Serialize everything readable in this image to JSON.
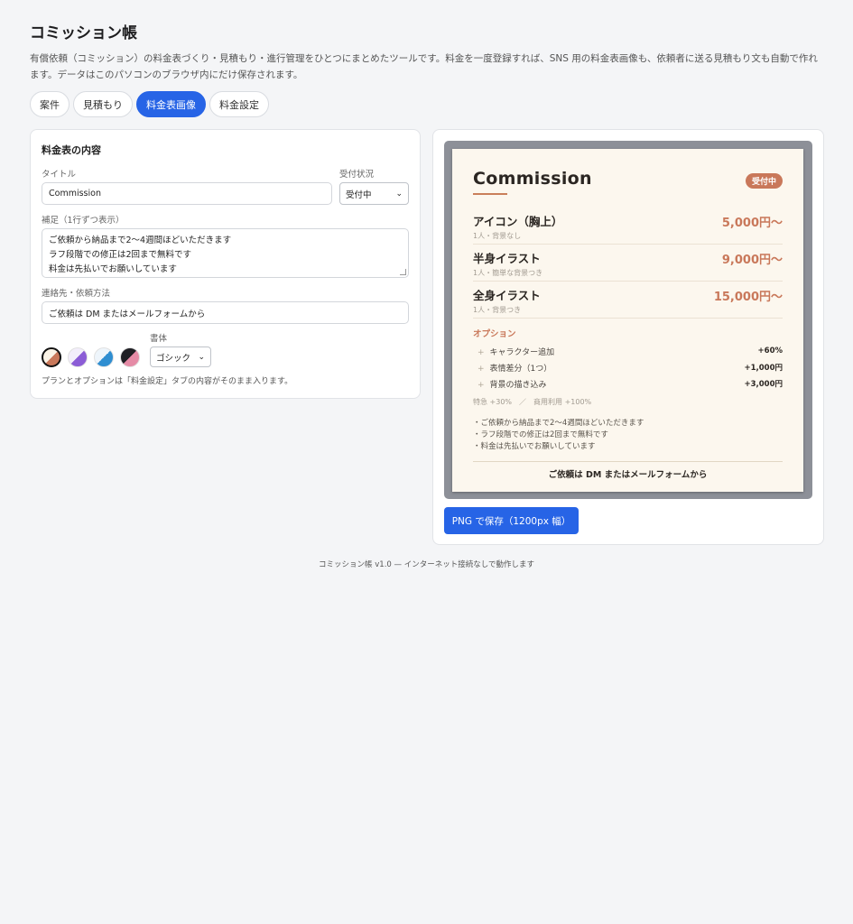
{
  "app": {
    "title": "コミッション帳",
    "description": "有償依頼（コミッション）の料金表づくり・見積もり・進行管理をひとつにまとめたツールです。料金を一度登録すれば、SNS 用の料金表画像も、依頼者に送る見積もり文も自動で作れます。データはこのパソコンのブラウザ内にだけ保存されます。"
  },
  "tabs": [
    {
      "label": "案件",
      "active": false
    },
    {
      "label": "見積もり",
      "active": false
    },
    {
      "label": "料金表画像",
      "active": true
    },
    {
      "label": "料金設定",
      "active": false
    }
  ],
  "form": {
    "section_title": "料金表の内容",
    "title_label": "タイトル",
    "title_value": "Commission",
    "status_label": "受付状況",
    "status_value": "受付中",
    "note_label": "補足（1行ずつ表示）",
    "note_lines": [
      "ご依頼から納品まで2〜4週間ほどいただきます",
      "ラフ段階での修正は2回まで無料です",
      "料金は先払いでお願いしています"
    ],
    "contact_label": "連絡先・依頼方法",
    "contact_value": "ご依頼は DM またはメールフォームから",
    "font_label": "書体",
    "font_value": "ゴシック",
    "themes": [
      {
        "name": "terracotta",
        "c1": "#faf3e6",
        "c2": "#c9785a",
        "active": true
      },
      {
        "name": "violet",
        "c1": "#f3eefb",
        "c2": "#8b5cd6",
        "active": false
      },
      {
        "name": "blue",
        "c1": "#eef5fb",
        "c2": "#2f8ed1",
        "active": false
      },
      {
        "name": "dark-pink",
        "c1": "#1f1f24",
        "c2": "#e58ba6",
        "active": false
      }
    ],
    "footnote": "プランとオプションは「料金設定」タブの内容がそのまま入ります。"
  },
  "preview": {
    "title": "Commission",
    "badge": "受付中",
    "plans": [
      {
        "name": "アイコン（胸上）",
        "sub": "1人・背景なし",
        "price": "5,000円〜"
      },
      {
        "name": "半身イラスト",
        "sub": "1人・簡単な背景つき",
        "price": "9,000円〜"
      },
      {
        "name": "全身イラスト",
        "sub": "1人・背景つき",
        "price": "15,000円〜"
      }
    ],
    "options_title": "オプション",
    "options": [
      {
        "name": "キャラクター追加",
        "price": "+60%"
      },
      {
        "name": "表情差分（1つ）",
        "price": "+1,000円"
      },
      {
        "name": "背景の描き込み",
        "price": "+3,000円"
      }
    ],
    "extras": "特急 +30%　／　商用利用 +100%",
    "notes": [
      "・ご依頼から納品まで2〜4週間ほどいただきます",
      "・ラフ段階での修正は2回まで無料です",
      "・料金は先払いでお願いしています"
    ],
    "contact": "ご依頼は DM またはメールフォームから"
  },
  "save_button": "PNG で保存（1200px 幅）",
  "footer": "コミッション帳 v1.0 — インターネット接続なしで動作します"
}
